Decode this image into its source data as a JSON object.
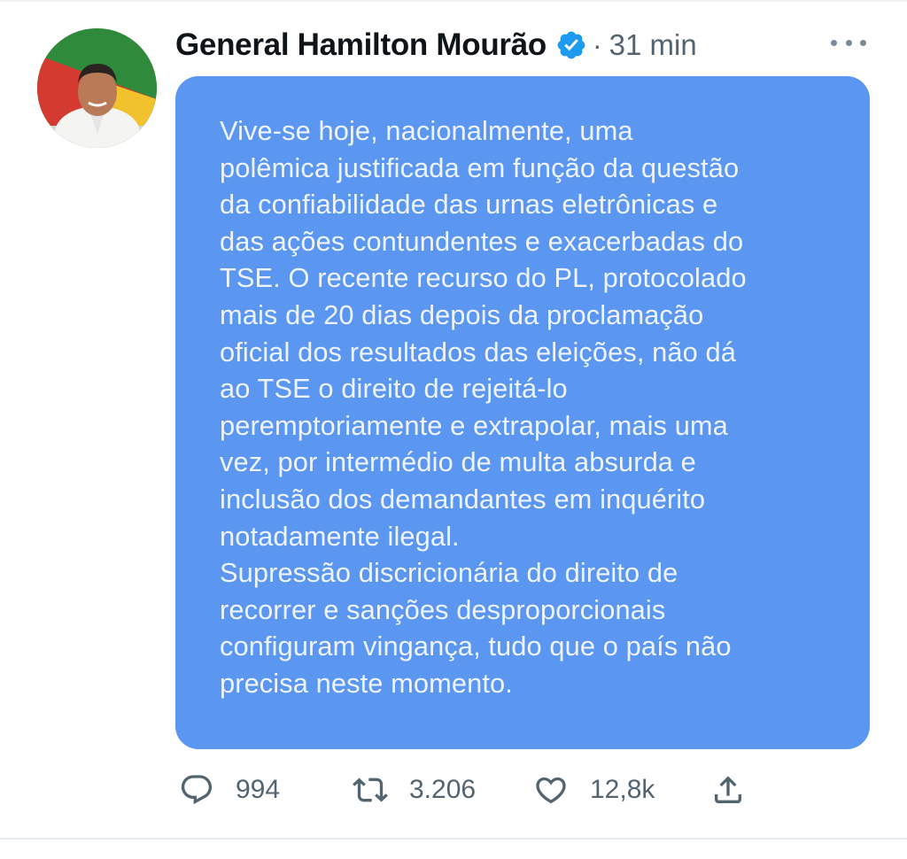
{
  "author": {
    "name": "General Hamilton Mourão",
    "time": "31 min",
    "separator": "·"
  },
  "tweet_image": {
    "lines": [
      "Vive-se hoje, nacionalmente, uma",
      "polêmica justificada em função da questão",
      "da confiabilidade das urnas eletrônicas e",
      "das ações contundentes e exacerbadas do",
      "TSE. O recente recurso do PL, protocolado",
      "mais de 20 dias depois da proclamação",
      "oficial dos resultados das eleições, não dá",
      "ao TSE o direito de rejeitá-lo",
      "peremptoriamente e extrapolar, mais uma",
      "vez, por intermédio de multa absurda e",
      "inclusão dos demandantes em inquérito",
      "notadamente ilegal.",
      "Supressão discricionária do direito de",
      "recorrer e sanções desproporcionais",
      "configuram vingança, tudo que o país não",
      "precisa neste momento."
    ],
    "background_color": "#5b97f1"
  },
  "actions": {
    "replies": "994",
    "retweets": "3.206",
    "likes": "12,8k"
  },
  "colors": {
    "verified": "#1d9bf0",
    "muted": "#536471"
  },
  "icons": [
    "verified-badge-icon",
    "more-icon",
    "reply-icon",
    "retweet-icon",
    "like-icon",
    "share-icon"
  ]
}
